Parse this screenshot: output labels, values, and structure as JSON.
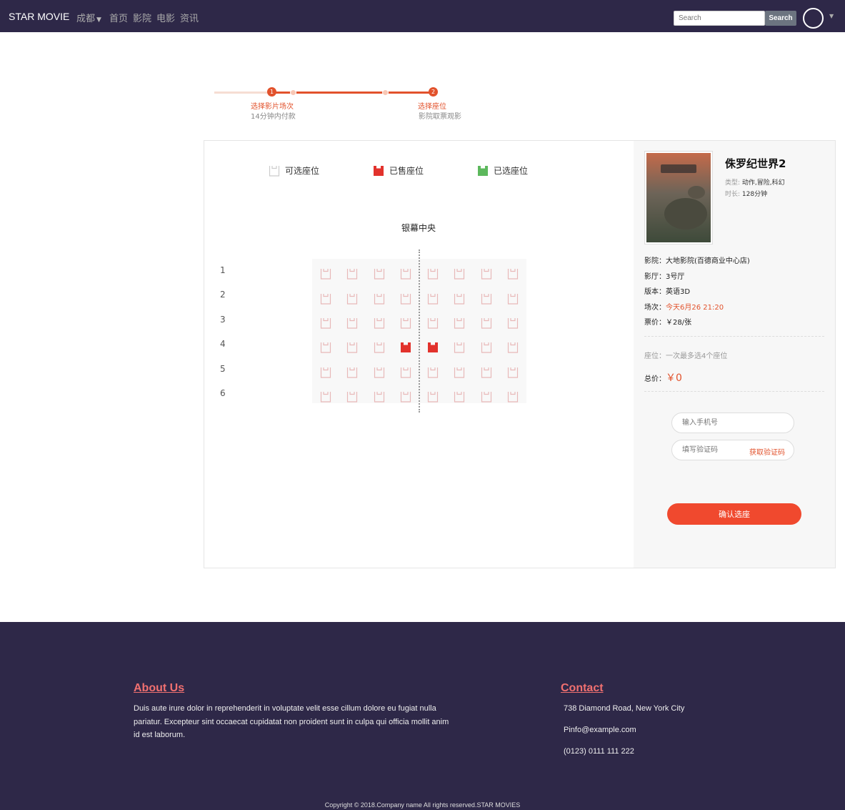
{
  "navbar": {
    "brand": "STAR MOVIE",
    "city": "成都",
    "links": [
      "首页",
      "影院",
      "电影",
      "资讯"
    ],
    "search_placeholder": "Search",
    "search_button": "Search"
  },
  "steps": {
    "step1_number": "1",
    "step1_title": "选择影片场次",
    "step1_sub": "14分钟内付款",
    "step2_number": "2",
    "step2_title": "选择座位",
    "step2_sub": "影院取票观影"
  },
  "legend": {
    "available": "可选座位",
    "sold": "已售座位",
    "selected": "已选座位"
  },
  "screen_label": "银幕中央",
  "rows": [
    "1",
    "2",
    "3",
    "4",
    "5",
    "6"
  ],
  "seats_per_row": 8,
  "sold_seats": [
    [
      4,
      4
    ],
    [
      4,
      5
    ]
  ],
  "colors": {
    "accent": "#e2522c",
    "sold": "#e2322c",
    "selected": "#5cb85c",
    "available_border": "#e8b8b8",
    "nav_bg": "#2e2848"
  },
  "movie": {
    "title": "侏罗纪世界2",
    "type_label": "类型:",
    "type_value": "动作,冒险,科幻",
    "duration_label": "时长:",
    "duration_value": "128分钟",
    "poster_title": "侏罗纪世界2"
  },
  "info": {
    "cinema": "影院：大地影院(百德商业中心店)",
    "hall": "影厅：3号厅",
    "version": "版本：英语3D",
    "session_label": "场次：",
    "session_value": "今天6月26 21:20",
    "price": "票价：￥28/张",
    "seat_note": "座位：一次最多选4个座位",
    "total_label": "总价：",
    "total_value": "￥0"
  },
  "form": {
    "phone_placeholder": "输入手机号",
    "code_placeholder": "填写验证码",
    "get_code": "获取验证码",
    "confirm": "确认选座"
  },
  "footer": {
    "about_title": "About Us",
    "about_text": "Duis aute irure dolor in reprehenderit in voluptate velit esse cillum dolore eu fugiat nulla pariatur. Excepteur sint occaecat cupidatat non proident sunt in culpa qui officia mollit anim id est laborum.",
    "contact_title": "Contact",
    "address": "738 Diamond Road, New York City",
    "email": "Pinfo@example.com",
    "phone": "(0123) 0111 111 222",
    "copyright": "Copyright © 2018.Company name All rights reserved.STAR MOVIES"
  }
}
